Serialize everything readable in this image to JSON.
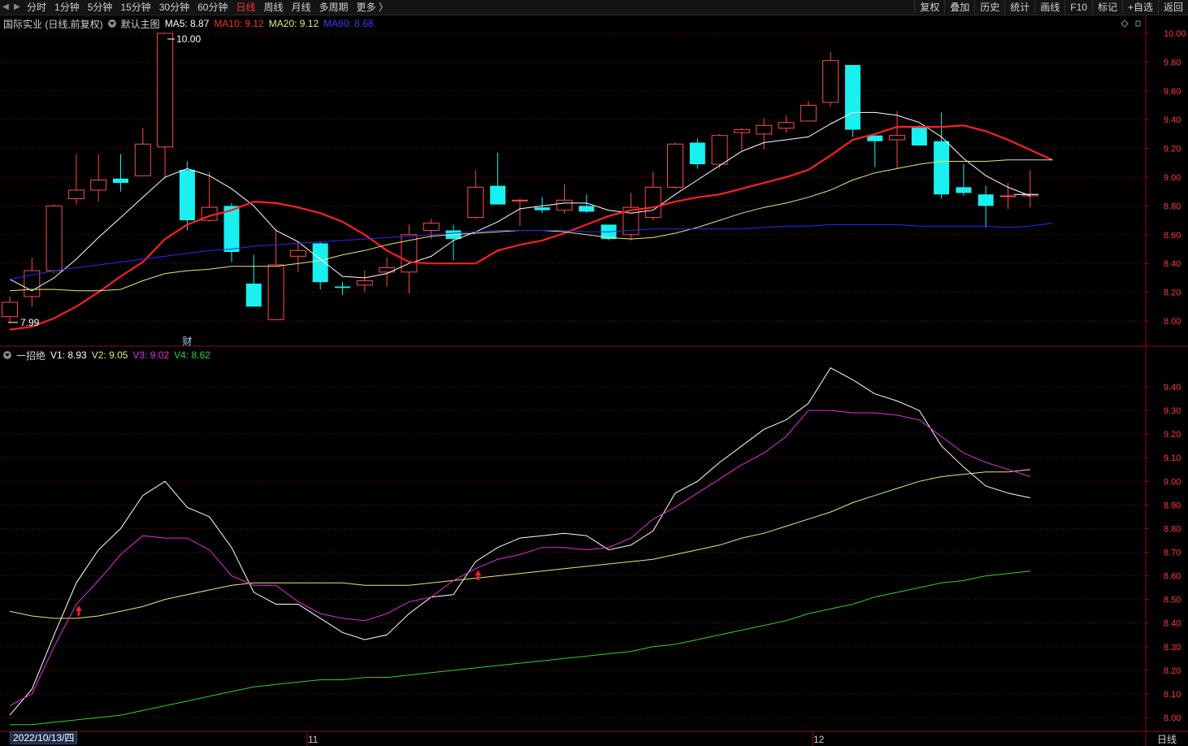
{
  "toolbar": {
    "periods": [
      "分时",
      "1分钟",
      "5分钟",
      "15分钟",
      "30分钟",
      "60分钟",
      "日线",
      "周线",
      "月线",
      "多周期",
      "更多 〉"
    ],
    "active_period": "日线",
    "right_buttons": [
      "复权",
      "叠加",
      "历史",
      "统计",
      "画线",
      "F10",
      "标记",
      "+自选",
      "返回"
    ]
  },
  "main_legend": {
    "stock": "国际实业 (日线,前复权)",
    "template": "默认主图",
    "ma5": "MA5: 8.87",
    "ma10": "MA10: 9.12",
    "ma20": "MA20: 9.12",
    "ma60": "MA60: 8.68"
  },
  "sub_legend": {
    "name": "一招绝",
    "v1": "V1: 8.93",
    "v2": "V2: 9.05",
    "v3": "V3: 9.02",
    "v4": "V4: 8.62"
  },
  "annotations": {
    "high_label": "10.00",
    "low_label": "7.99",
    "finance_marker": "财"
  },
  "axis": {
    "date_label": "2022/10/13/四",
    "month_labels": [
      "11",
      "12"
    ],
    "bottom_right": "日线",
    "main_ticks": [
      "10.00",
      "9.80",
      "9.60",
      "9.40",
      "9.20",
      "9.00",
      "8.80",
      "8.60",
      "8.40",
      "8.20",
      "8.00"
    ],
    "sub_ticks": [
      "9.40",
      "9.30",
      "9.20",
      "9.10",
      "9.00",
      "8.90",
      "8.80",
      "8.70",
      "8.60",
      "8.50",
      "8.40",
      "8.30",
      "8.20",
      "8.10",
      "8.00"
    ]
  },
  "colors": {
    "up": "#ff4a4a",
    "down": "#19f0f0",
    "ma5": "#ffffff",
    "ma10": "#ff2020",
    "ma20": "#e8e87a",
    "ma60": "#2a2aff",
    "v1": "#ffffff",
    "v2": "#e8e87a",
    "v3": "#e030e0",
    "v4": "#30d030",
    "grid": "#7a1010"
  },
  "chart_data": [
    {
      "type": "candlestick",
      "title": "国际实业 (日线,前复权)",
      "ylim": [
        7.9,
        10.05
      ],
      "candles": [
        {
          "o": 8.03,
          "h": 8.17,
          "l": 7.99,
          "c": 8.13
        },
        {
          "o": 8.17,
          "h": 8.44,
          "l": 8.1,
          "c": 8.35
        },
        {
          "o": 8.35,
          "h": 8.81,
          "l": 8.33,
          "c": 8.8
        },
        {
          "o": 8.85,
          "h": 9.16,
          "l": 8.81,
          "c": 8.91
        },
        {
          "o": 8.91,
          "h": 9.16,
          "l": 8.83,
          "c": 8.98
        },
        {
          "o": 8.99,
          "h": 9.16,
          "l": 8.9,
          "c": 8.96
        },
        {
          "o": 9.01,
          "h": 9.34,
          "l": 9.01,
          "c": 9.23
        },
        {
          "o": 9.21,
          "h": 10.0,
          "l": 8.99,
          "c": 10.0
        },
        {
          "o": 9.05,
          "h": 9.11,
          "l": 8.63,
          "c": 8.7
        },
        {
          "o": 8.7,
          "h": 9.04,
          "l": 8.69,
          "c": 8.79
        },
        {
          "o": 8.8,
          "h": 8.82,
          "l": 8.41,
          "c": 8.48
        },
        {
          "o": 8.26,
          "h": 8.46,
          "l": 8.1,
          "c": 8.1
        },
        {
          "o": 8.01,
          "h": 8.64,
          "l": 8.01,
          "c": 8.39
        },
        {
          "o": 8.45,
          "h": 8.55,
          "l": 8.34,
          "c": 8.49
        },
        {
          "o": 8.54,
          "h": 8.55,
          "l": 8.22,
          "c": 8.27
        },
        {
          "o": 8.24,
          "h": 8.27,
          "l": 8.18,
          "c": 8.23
        },
        {
          "o": 8.25,
          "h": 8.35,
          "l": 8.2,
          "c": 8.28
        },
        {
          "o": 8.34,
          "h": 8.44,
          "l": 8.24,
          "c": 8.37
        },
        {
          "o": 8.34,
          "h": 8.67,
          "l": 8.19,
          "c": 8.6
        },
        {
          "o": 8.63,
          "h": 8.71,
          "l": 8.57,
          "c": 8.68
        },
        {
          "o": 8.63,
          "h": 8.67,
          "l": 8.42,
          "c": 8.57
        },
        {
          "o": 8.72,
          "h": 9.05,
          "l": 8.71,
          "c": 8.93
        },
        {
          "o": 8.94,
          "h": 9.17,
          "l": 8.81,
          "c": 8.81
        },
        {
          "o": 8.84,
          "h": 8.85,
          "l": 8.66,
          "c": 8.84
        },
        {
          "o": 8.79,
          "h": 8.86,
          "l": 8.75,
          "c": 8.77
        },
        {
          "o": 8.77,
          "h": 8.95,
          "l": 8.75,
          "c": 8.84
        },
        {
          "o": 8.8,
          "h": 8.88,
          "l": 8.75,
          "c": 8.76
        },
        {
          "o": 8.67,
          "h": 8.67,
          "l": 8.56,
          "c": 8.57
        },
        {
          "o": 8.6,
          "h": 8.89,
          "l": 8.56,
          "c": 8.79
        },
        {
          "o": 8.72,
          "h": 9.04,
          "l": 8.7,
          "c": 8.93
        },
        {
          "o": 8.93,
          "h": 9.24,
          "l": 8.92,
          "c": 9.23
        },
        {
          "o": 9.24,
          "h": 9.27,
          "l": 9.06,
          "c": 9.09
        },
        {
          "o": 9.09,
          "h": 9.3,
          "l": 9.06,
          "c": 9.29
        },
        {
          "o": 9.31,
          "h": 9.34,
          "l": 9.19,
          "c": 9.33
        },
        {
          "o": 9.3,
          "h": 9.41,
          "l": 9.19,
          "c": 9.36
        },
        {
          "o": 9.34,
          "h": 9.43,
          "l": 9.31,
          "c": 9.38
        },
        {
          "o": 9.39,
          "h": 9.53,
          "l": 9.39,
          "c": 9.5
        },
        {
          "o": 9.52,
          "h": 9.87,
          "l": 9.49,
          "c": 9.81
        },
        {
          "o": 9.78,
          "h": 9.78,
          "l": 9.28,
          "c": 9.33
        },
        {
          "o": 9.29,
          "h": 9.29,
          "l": 9.07,
          "c": 9.25
        },
        {
          "o": 9.26,
          "h": 9.46,
          "l": 9.06,
          "c": 9.29
        },
        {
          "o": 9.35,
          "h": 9.36,
          "l": 9.22,
          "c": 9.22
        },
        {
          "o": 9.25,
          "h": 9.45,
          "l": 8.85,
          "c": 8.88
        },
        {
          "o": 8.93,
          "h": 9.09,
          "l": 8.87,
          "c": 8.89
        },
        {
          "o": 8.88,
          "h": 8.94,
          "l": 8.65,
          "c": 8.8
        },
        {
          "o": 8.87,
          "h": 8.96,
          "l": 8.78,
          "c": 8.87
        },
        {
          "o": 8.87,
          "h": 9.05,
          "l": 8.79,
          "c": 8.88
        }
      ],
      "series": [
        {
          "name": "MA5",
          "values": [
            8.29,
            8.21,
            8.3,
            8.43,
            8.58,
            8.72,
            8.86,
            9.0,
            9.06,
            9.01,
            8.92,
            8.8,
            8.63,
            8.55,
            8.43,
            8.31,
            8.3,
            8.33,
            8.4,
            8.45,
            8.56,
            8.62,
            8.69,
            8.78,
            8.8,
            8.82,
            8.82,
            8.77,
            8.75,
            8.77,
            8.88,
            8.98,
            9.08,
            9.18,
            9.24,
            9.26,
            9.28,
            9.37,
            9.45,
            9.45,
            9.43,
            9.38,
            9.28,
            9.13,
            9.01,
            8.93,
            8.87
          ]
        },
        {
          "name": "MA10",
          "values": [
            7.94,
            7.96,
            8.02,
            8.1,
            8.2,
            8.31,
            8.41,
            8.57,
            8.67,
            8.73,
            8.77,
            8.83,
            8.82,
            8.79,
            8.75,
            8.69,
            8.6,
            8.49,
            8.41,
            8.4,
            8.4,
            8.4,
            8.49,
            8.53,
            8.56,
            8.61,
            8.67,
            8.73,
            8.77,
            8.79,
            8.83,
            8.86,
            8.88,
            8.92,
            8.96,
            9.0,
            9.05,
            9.15,
            9.26,
            9.3,
            9.35,
            9.35,
            9.35,
            9.36,
            9.32,
            9.26,
            9.19,
            9.12
          ]
        },
        {
          "name": "MA20",
          "values": [
            8.21,
            8.22,
            8.22,
            8.21,
            8.21,
            8.22,
            8.28,
            8.33,
            8.35,
            8.36,
            8.38,
            8.38,
            8.38,
            8.4,
            8.42,
            8.46,
            8.49,
            8.53,
            8.56,
            8.59,
            8.6,
            8.61,
            8.62,
            8.63,
            8.63,
            8.62,
            8.6,
            8.58,
            8.57,
            8.58,
            8.61,
            8.65,
            8.7,
            8.75,
            8.79,
            8.82,
            8.86,
            8.91,
            8.98,
            9.03,
            9.06,
            9.09,
            9.11,
            9.11,
            9.11,
            9.12,
            9.12,
            9.12
          ]
        },
        {
          "name": "MA60",
          "values": [
            8.29,
            8.32,
            8.35,
            8.37,
            8.39,
            8.41,
            8.43,
            8.45,
            8.47,
            8.49,
            8.5,
            8.52,
            8.53,
            8.54,
            8.55,
            8.56,
            8.57,
            8.58,
            8.59,
            8.6,
            8.61,
            8.62,
            8.63,
            8.63,
            8.63,
            8.63,
            8.62,
            8.62,
            8.63,
            8.64,
            8.64,
            8.64,
            8.64,
            8.64,
            8.65,
            8.66,
            8.66,
            8.67,
            8.67,
            8.67,
            8.67,
            8.66,
            8.66,
            8.66,
            8.66,
            8.65,
            8.66,
            8.68
          ]
        }
      ]
    },
    {
      "type": "line",
      "title": "一招绝",
      "ylim": [
        7.96,
        9.48
      ],
      "series": [
        {
          "name": "V1",
          "values": [
            8.01,
            8.12,
            8.35,
            8.57,
            8.71,
            8.8,
            8.94,
            9.0,
            8.89,
            8.85,
            8.72,
            8.53,
            8.48,
            8.48,
            8.42,
            8.36,
            8.33,
            8.35,
            8.44,
            8.51,
            8.52,
            8.66,
            8.72,
            8.76,
            8.77,
            8.78,
            8.77,
            8.71,
            8.73,
            8.79,
            8.95,
            9.0,
            9.08,
            9.15,
            9.22,
            9.26,
            9.33,
            9.48,
            9.43,
            9.37,
            9.34,
            9.3,
            9.15,
            9.06,
            8.98,
            8.95,
            8.93
          ]
        },
        {
          "name": "V2",
          "values": [
            8.45,
            8.43,
            8.42,
            8.42,
            8.43,
            8.45,
            8.47,
            8.5,
            8.52,
            8.54,
            8.56,
            8.57,
            8.57,
            8.57,
            8.57,
            8.57,
            8.56,
            8.56,
            8.56,
            8.57,
            8.58,
            8.59,
            8.6,
            8.61,
            8.62,
            8.63,
            8.64,
            8.65,
            8.66,
            8.67,
            8.69,
            8.71,
            8.73,
            8.76,
            8.78,
            8.81,
            8.84,
            8.87,
            8.91,
            8.94,
            8.97,
            9.0,
            9.02,
            9.03,
            9.04,
            9.04,
            9.05
          ]
        },
        {
          "name": "V3",
          "values": [
            8.05,
            8.1,
            8.3,
            8.48,
            8.58,
            8.69,
            8.77,
            8.76,
            8.76,
            8.71,
            8.6,
            8.56,
            8.56,
            8.49,
            8.44,
            8.42,
            8.41,
            8.44,
            8.49,
            8.51,
            8.58,
            8.63,
            8.67,
            8.69,
            8.72,
            8.72,
            8.71,
            8.72,
            8.76,
            8.84,
            8.89,
            8.95,
            9.01,
            9.07,
            9.12,
            9.19,
            9.3,
            9.3,
            9.29,
            9.29,
            9.28,
            9.26,
            9.19,
            9.12,
            9.08,
            9.05,
            9.02
          ]
        },
        {
          "name": "V4",
          "values": [
            7.97,
            7.97,
            7.98,
            7.99,
            8.0,
            8.01,
            8.03,
            8.05,
            8.07,
            8.09,
            8.11,
            8.13,
            8.14,
            8.15,
            8.16,
            8.16,
            8.17,
            8.17,
            8.18,
            8.19,
            8.2,
            8.21,
            8.22,
            8.23,
            8.24,
            8.25,
            8.26,
            8.27,
            8.28,
            8.3,
            8.31,
            8.33,
            8.35,
            8.37,
            8.39,
            8.41,
            8.44,
            8.46,
            8.48,
            8.51,
            8.53,
            8.55,
            8.57,
            8.58,
            8.6,
            8.61,
            8.62
          ]
        }
      ],
      "buy_signals": [
        3,
        21
      ]
    }
  ]
}
